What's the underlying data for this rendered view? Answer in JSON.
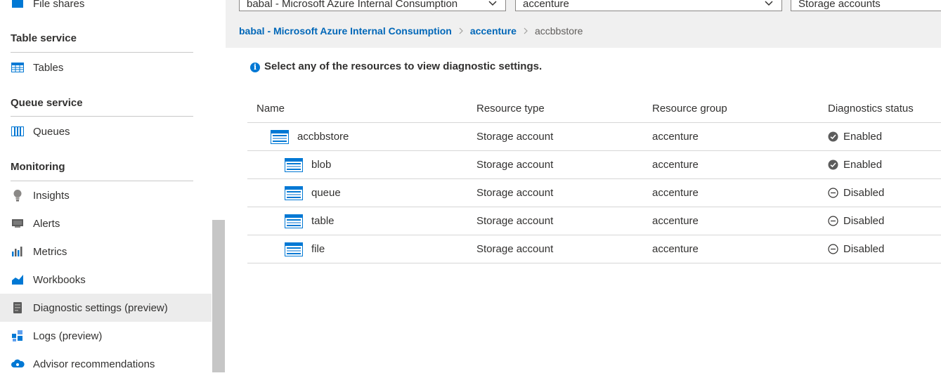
{
  "sidebar": {
    "partial_item": {
      "label": "File shares",
      "icon": "file-shares-icon"
    },
    "sections": [
      {
        "title": "Table service",
        "items": [
          {
            "label": "Tables",
            "icon": "tables-icon"
          }
        ]
      },
      {
        "title": "Queue service",
        "items": [
          {
            "label": "Queues",
            "icon": "queues-icon"
          }
        ]
      },
      {
        "title": "Monitoring",
        "items": [
          {
            "label": "Insights",
            "icon": "insights-bulb-icon"
          },
          {
            "label": "Alerts",
            "icon": "alerts-icon"
          },
          {
            "label": "Metrics",
            "icon": "metrics-bar-icon"
          },
          {
            "label": "Workbooks",
            "icon": "workbooks-icon"
          },
          {
            "label": "Diagnostic settings (preview)",
            "icon": "diagnostic-settings-icon",
            "selected": true
          },
          {
            "label": "Logs (preview)",
            "icon": "logs-icon"
          },
          {
            "label": "Advisor recommendations",
            "icon": "advisor-cloud-icon"
          }
        ]
      }
    ]
  },
  "filters": {
    "subscription": "babal - Microsoft Azure Internal Consumption",
    "resource_group": "accenture",
    "resource_type": "Storage accounts"
  },
  "breadcrumb": {
    "subscription": "babal - Microsoft Azure Internal Consumption",
    "resource_group": "accenture",
    "current": "accbbstore"
  },
  "info_message": "Select any of the resources to view diagnostic settings.",
  "table": {
    "headers": {
      "name": "Name",
      "type": "Resource type",
      "group": "Resource group",
      "status": "Diagnostics status"
    },
    "rows": [
      {
        "name": "accbbstore",
        "type": "Storage account",
        "group": "accenture",
        "status": "Enabled",
        "status_kind": "enabled",
        "level": 0
      },
      {
        "name": "blob",
        "type": "Storage account",
        "group": "accenture",
        "status": "Enabled",
        "status_kind": "enabled",
        "level": 1
      },
      {
        "name": "queue",
        "type": "Storage account",
        "group": "accenture",
        "status": "Disabled",
        "status_kind": "disabled",
        "level": 1
      },
      {
        "name": "table",
        "type": "Storage account",
        "group": "accenture",
        "status": "Disabled",
        "status_kind": "disabled",
        "level": 1
      },
      {
        "name": "file",
        "type": "Storage account",
        "group": "accenture",
        "status": "Disabled",
        "status_kind": "disabled",
        "level": 1
      }
    ]
  },
  "colors": {
    "link": "#0067b8",
    "accent": "#0078d4",
    "selected_bg": "#ececec"
  }
}
